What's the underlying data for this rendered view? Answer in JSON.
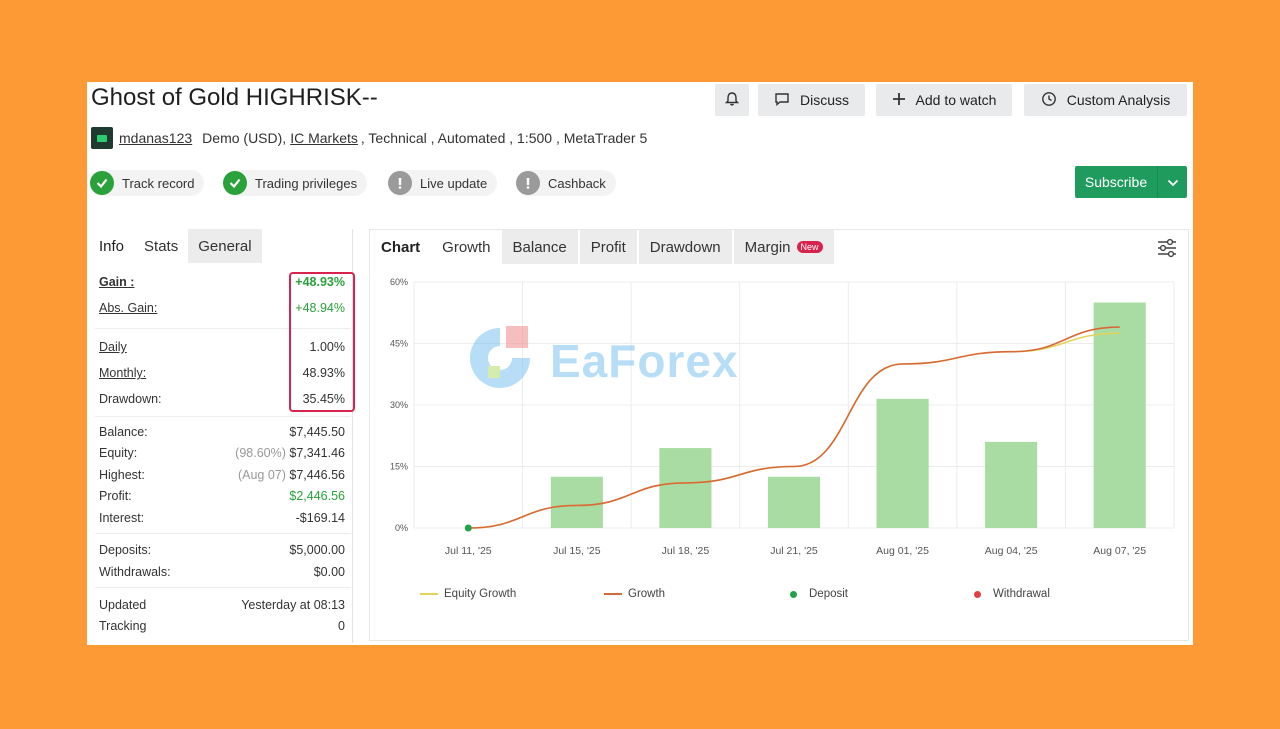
{
  "header": {
    "title": "Ghost of Gold HIGHRISK--",
    "discuss_label": "Discuss",
    "watch_label": "Add to watch",
    "custom_label": "Custom Analysis"
  },
  "meta": {
    "username": "mdanas123",
    "account": "Demo (USD),",
    "broker": "IC Markets",
    "rest": ", Technical , Automated , 1:500 , MetaTrader 5"
  },
  "badges": [
    {
      "label": "Track record",
      "status": "ok"
    },
    {
      "label": "Trading privileges",
      "status": "ok"
    },
    {
      "label": "Live update",
      "status": "warn"
    },
    {
      "label": "Cashback",
      "status": "warn"
    }
  ],
  "subscribe_label": "Subscribe",
  "left_tabs": [
    "Info",
    "Stats",
    "General"
  ],
  "stats": {
    "gain": {
      "label": "Gain :",
      "value": "+48.93%"
    },
    "abs_gain": {
      "label": "Abs. Gain:",
      "value": "+48.94%"
    },
    "daily": {
      "label": "Daily",
      "value": "1.00%"
    },
    "monthly": {
      "label": "Monthly:",
      "value": "48.93%"
    },
    "drawdown": {
      "label": "Drawdown:",
      "value": "35.45%"
    },
    "balance": {
      "label": "Balance:",
      "value": "$7,445.50"
    },
    "equity": {
      "label": "Equity:",
      "note": "(98.60%)",
      "value": "$7,341.46"
    },
    "highest": {
      "label": "Highest:",
      "note": "(Aug 07)",
      "value": "$7,446.56"
    },
    "profit": {
      "label": "Profit:",
      "value": "$2,446.56"
    },
    "interest": {
      "label": "Interest:",
      "value": "-$169.14"
    },
    "deposits": {
      "label": "Deposits:",
      "value": "$5,000.00"
    },
    "withdrawals": {
      "label": "Withdrawals:",
      "value": "$0.00"
    },
    "updated": {
      "label": "Updated",
      "value": "Yesterday at 08:13"
    },
    "tracking": {
      "label": "Tracking",
      "value": "0"
    }
  },
  "chart_tabs": {
    "chart": "Chart",
    "growth": "Growth",
    "balance": "Balance",
    "profit": "Profit",
    "drawdown": "Drawdown",
    "margin": "Margin",
    "new_tag": "New"
  },
  "watermark": "EaForex",
  "chart_data": {
    "type": "bar",
    "categories": [
      "Jul 11, '25",
      "Jul 15, '25",
      "Jul 18, '25",
      "Jul 21, '25",
      "Aug 01, '25",
      "Aug 04, '25",
      "Aug 07, '25"
    ],
    "y_ticks": [
      "0%",
      "15%",
      "30%",
      "45%",
      "60%"
    ],
    "ylim": [
      0,
      60
    ],
    "grid": true,
    "series": [
      {
        "name": "Growth",
        "kind": "bar",
        "values": [
          0,
          12.5,
          19.5,
          12.5,
          31.5,
          21,
          55
        ],
        "color": "#a8dca3"
      },
      {
        "name": "Growth",
        "kind": "line",
        "values": [
          0,
          5.5,
          11,
          15,
          40,
          43,
          49
        ],
        "color": "#d86a3a"
      },
      {
        "name": "Equity Growth",
        "kind": "line",
        "values": [
          0,
          5.5,
          11,
          15,
          40,
          43,
          47.5
        ],
        "color": "#e3d35a"
      }
    ],
    "deposit_points": [
      {
        "x": "Jul 11, '25",
        "y": 0
      }
    ],
    "legend": [
      {
        "label": "Equity Growth",
        "kind": "line",
        "color": "#e3d35a"
      },
      {
        "label": "Growth",
        "kind": "line",
        "color": "#d86a3a"
      },
      {
        "label": "Deposit",
        "kind": "dot",
        "color": "#1fa24a"
      },
      {
        "label": "Withdrawal",
        "kind": "dot",
        "color": "#e04040"
      }
    ]
  }
}
